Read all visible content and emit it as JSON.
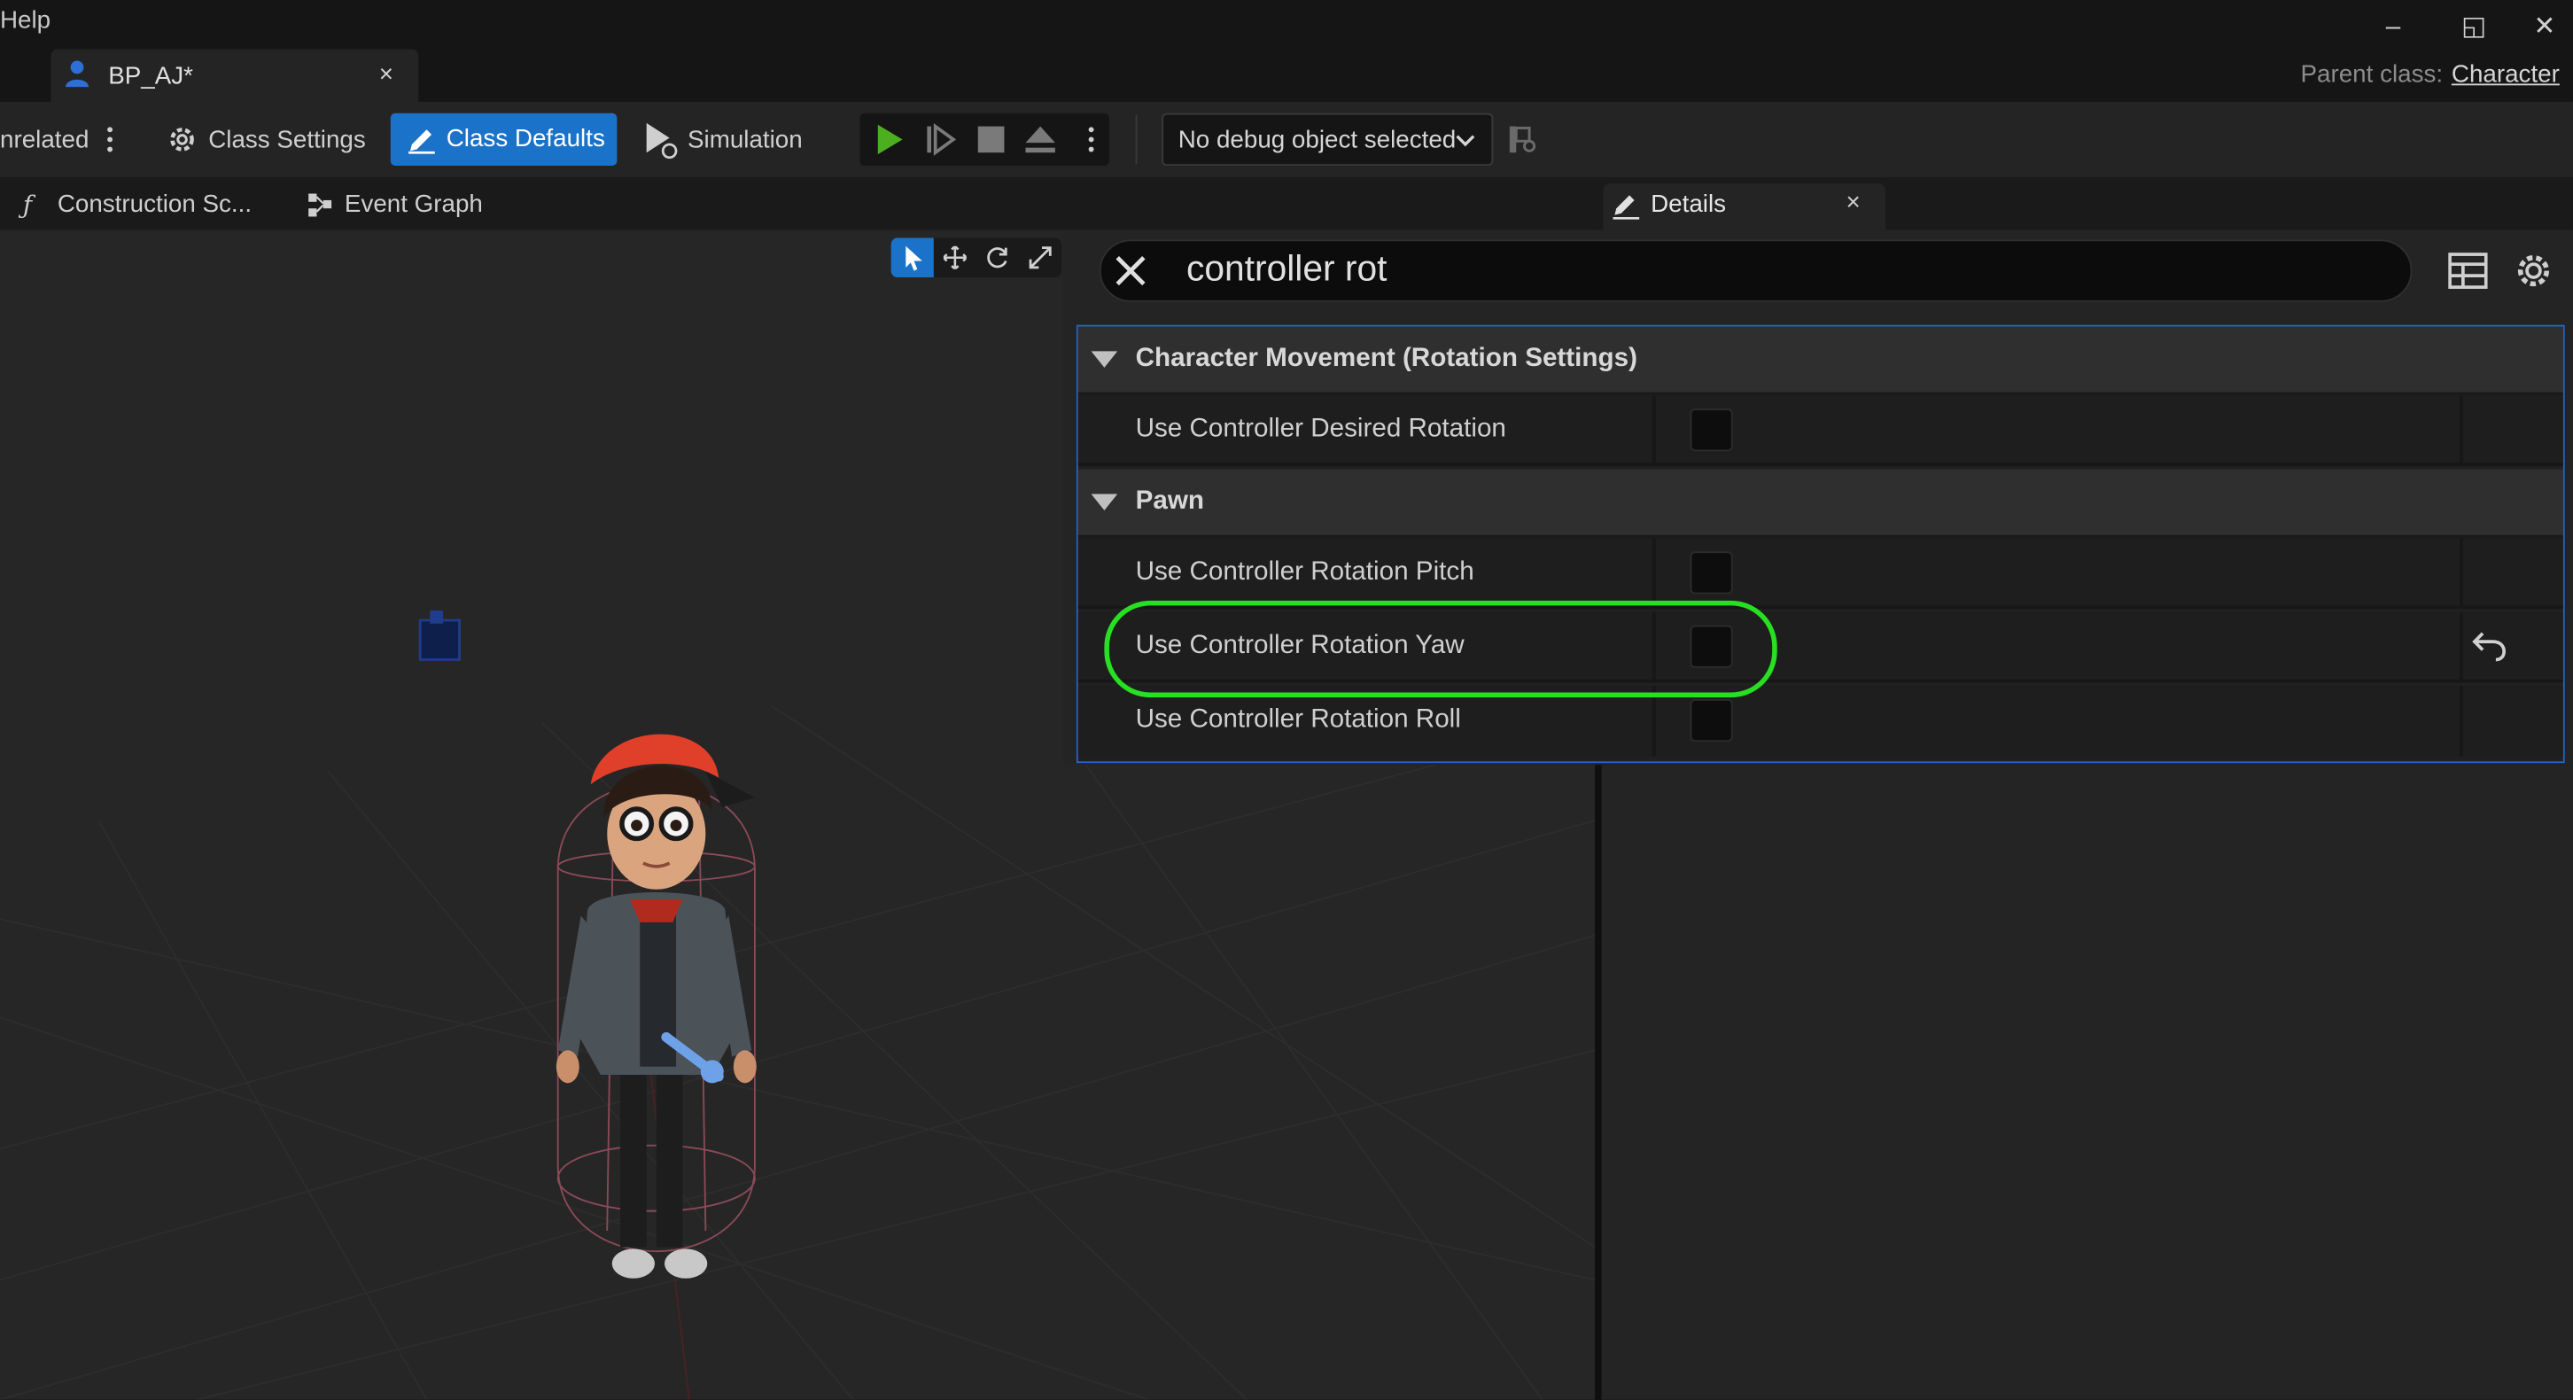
{
  "menu": {
    "help": "Help"
  },
  "window_controls": {
    "minimize": "–",
    "restore": "◱",
    "close": "✕"
  },
  "document_tab": {
    "title": "BP_AJ*",
    "close": "×",
    "icon": "blueprint-character-icon"
  },
  "parent_class": {
    "label": "Parent class:",
    "value": "Character"
  },
  "toolbar": {
    "hide_unrelated": "nrelated",
    "class_settings": "Class Settings",
    "class_defaults": "Class Defaults",
    "simulation": "Simulation",
    "debug_object": "No debug object selected",
    "accent_color": "#1b73c9"
  },
  "subtabs": {
    "construction_script": "Construction Sc...",
    "event_graph": "Event Graph",
    "details": "Details",
    "details_close": "×"
  },
  "details": {
    "search_value": "controller rot",
    "categories": [
      {
        "name": "Character Movement (Rotation Settings)",
        "properties": [
          {
            "label": "Use Controller Desired Rotation",
            "checked": false
          }
        ]
      },
      {
        "name": "Pawn",
        "properties": [
          {
            "label": "Use Controller Rotation Pitch",
            "checked": false
          },
          {
            "label": "Use Controller Rotation Yaw",
            "checked": false,
            "modified": true
          },
          {
            "label": "Use Controller Rotation Roll",
            "checked": false
          }
        ]
      }
    ]
  },
  "annotation": {
    "highlight_color": "#27e022",
    "target": "Use Controller Rotation Yaw"
  }
}
